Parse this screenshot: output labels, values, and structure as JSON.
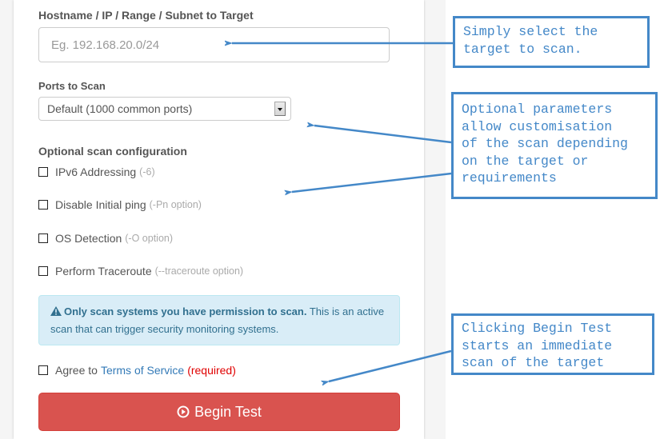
{
  "form": {
    "target_label": "Hostname / IP / Range / Subnet to Target",
    "target_placeholder": "Eg. 192.168.20.0/24",
    "target_value": "",
    "ports_label": "Ports to Scan",
    "ports_selected": "Default (1000 common ports)",
    "optional_label": "Optional scan configuration",
    "options": [
      {
        "label": "IPv6 Addressing",
        "hint": "(-6)",
        "checked": false
      },
      {
        "label": "Disable Initial ping",
        "hint": "(-Pn option)",
        "checked": false
      },
      {
        "label": "OS Detection",
        "hint": "(-O option)",
        "checked": false
      },
      {
        "label": "Perform Traceroute",
        "hint": "(--traceroute option)",
        "checked": false
      }
    ],
    "alert": {
      "icon": "warning-icon",
      "bold": "Only scan systems you have permission to scan.",
      "text": "This is an active scan that can trigger security monitoring systems."
    },
    "agree": {
      "prefix": "Agree to",
      "link": "Terms of Service",
      "required": "(required)",
      "checked": false
    },
    "begin_button": {
      "icon": "play-circle-icon",
      "label": "Begin Test"
    }
  },
  "annotations": [
    {
      "text": "Simply select the\ntarget to scan."
    },
    {
      "text": "Optional parameters\nallow customisation\nof the scan depending\non the target or\nrequirements"
    },
    {
      "text": "Clicking Begin Test\nstarts an immediate\nscan of the target"
    }
  ],
  "colors": {
    "annotation": "#4488c8",
    "danger": "#d9534f",
    "info_bg": "#d9edf7",
    "info_text": "#31708f",
    "link": "#337ab7",
    "required": "#e00000"
  }
}
